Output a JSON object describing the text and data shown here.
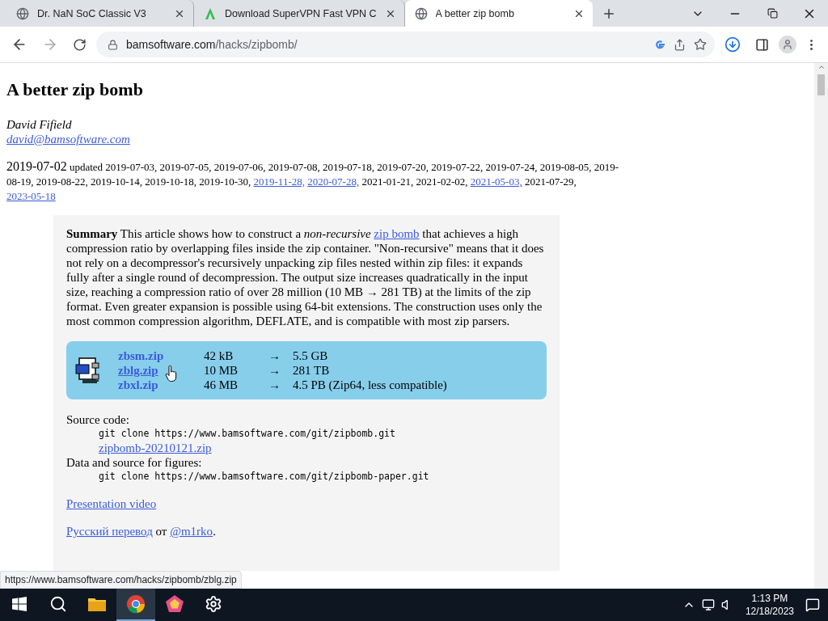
{
  "tabs": [
    {
      "title": "Dr. NaN SoC Classic V3",
      "selected": false
    },
    {
      "title": "Download SuperVPN Fast VPN C",
      "selected": false
    },
    {
      "title": "A better zip bomb",
      "selected": true
    }
  ],
  "address": {
    "host": "bamsoftware.com",
    "path": "/hacks/zipbomb/"
  },
  "page": {
    "title": "A better zip bomb",
    "author": "David Fifield",
    "email": "david@bamsoftware.com",
    "date": "2019-07-02",
    "updated_label": "updated",
    "updates": [
      {
        "text": "2019-07-03,",
        "link": false
      },
      {
        "text": "2019-07-05,",
        "link": false
      },
      {
        "text": "2019-07-06,",
        "link": false
      },
      {
        "text": "2019-07-08,",
        "link": false
      },
      {
        "text": "2019-07-18,",
        "link": false
      },
      {
        "text": "2019-07-20,",
        "link": false
      },
      {
        "text": "2019-07-22,",
        "link": false
      },
      {
        "text": "2019-07-24,",
        "link": false
      },
      {
        "text": "2019-08-05,",
        "link": false
      },
      {
        "text": "2019-08-19,",
        "link": false
      },
      {
        "text": "2019-08-22,",
        "link": false
      },
      {
        "text": "2019-10-14,",
        "link": false
      },
      {
        "text": "2019-10-18,",
        "link": false
      },
      {
        "text": "2019-10-30,",
        "link": false
      },
      {
        "text": "2019-11-28,",
        "link": true
      },
      {
        "text": "2020-07-28,",
        "link": true
      },
      {
        "text": "2021-01-21,",
        "link": false
      },
      {
        "text": "2021-02-02,",
        "link": false
      },
      {
        "text": "2021-05-03,",
        "link": true
      },
      {
        "text": "2021-07-29,",
        "link": false
      },
      {
        "text": "2023-05-18",
        "link": true
      }
    ],
    "summary": {
      "before": "**Summary**     This article shows how to construct a *non-recursive*",
      "link": "zip bomb",
      "after": "that achieves a high compression ratio by overlapping files inside the zip container. \"Non-recursive\" means that it does not rely on a decompressor's recursively unpacking zip files nested within zip files: it expands fully after a single round of decompression. The output size increases quadratically in the input size, reaching a compression ratio of over 28 million (10 MB → 281 TB) at the limits of the zip format. Even greater expansion is possible using 64-bit extensions. The construction uses only the most common compression algorithm, DEFLATE, and is compatible with most zip parsers."
    },
    "downloads": [
      {
        "file": "zbsm.zip",
        "size": "42 kB",
        "arrow": "→",
        "result": "5.5 GB",
        "hovered": false
      },
      {
        "file": "zblg.zip",
        "size": "10 MB",
        "arrow": "→",
        "result": "281 TB",
        "hovered": true
      },
      {
        "file": "zbxl.zip",
        "size": "46 MB",
        "arrow": "→",
        "result": "4.5 PB (Zip64, less compatible)",
        "hovered": false
      }
    ],
    "source": [
      {
        "kind": "label",
        "text": "Source code:"
      },
      {
        "kind": "code",
        "text": "git clone https://www.bamsoftware.com/git/zipbomb.git"
      },
      {
        "kind": "link",
        "text": "zipbomb-20210121.zip"
      },
      {
        "kind": "label",
        "text": "Data and source for figures:"
      },
      {
        "kind": "code",
        "text": "git clone https://www.bamsoftware.com/git/zipbomb-paper.git"
      }
    ],
    "video_link": "Presentation video",
    "translation": {
      "link": "Русский перевод",
      "middle": "от",
      "author": "@m1rko",
      "end": "."
    }
  },
  "status_url": "https://www.bamsoftware.com/hacks/zipbomb/zblg.zip",
  "taskbar": {
    "apps": [
      {
        "active": false
      },
      {
        "active": false
      },
      {
        "active": true
      },
      {
        "active": false
      },
      {
        "active": false
      }
    ],
    "time": "1:13 PM",
    "date": "12/18/2023"
  }
}
